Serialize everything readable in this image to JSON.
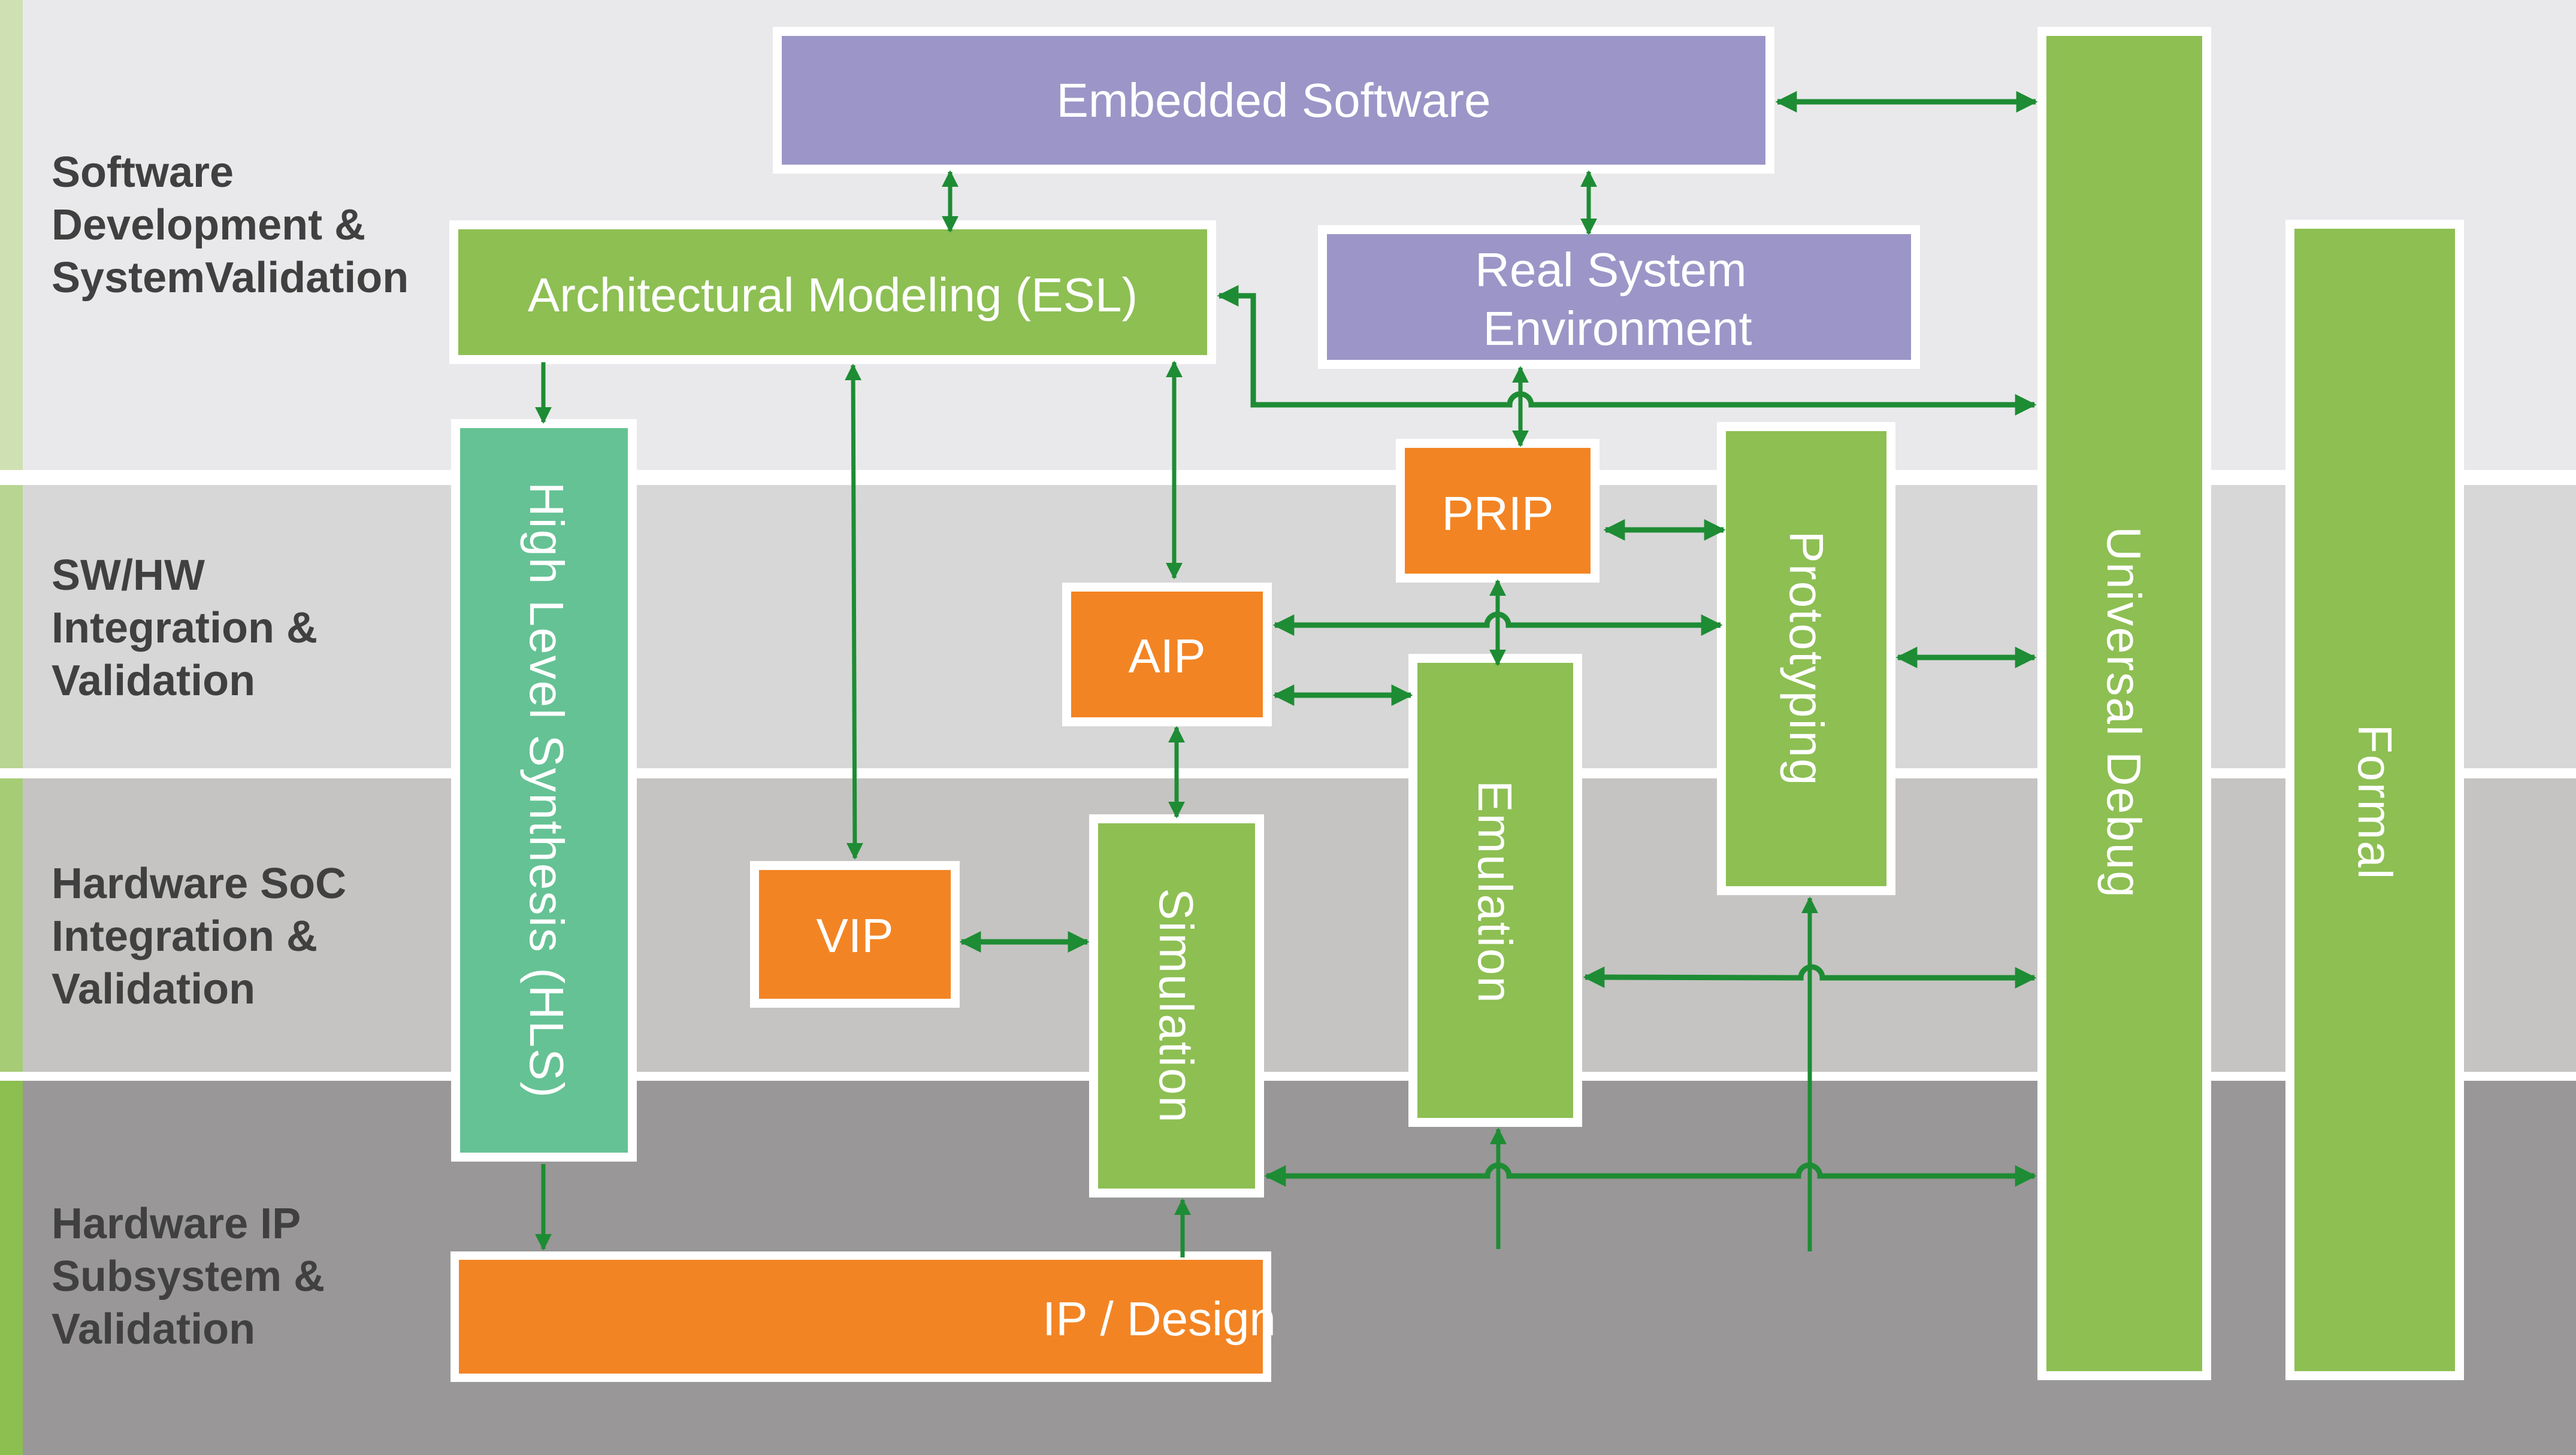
{
  "colors": {
    "band_1": "#e9e9eb",
    "band_2": "#d7d7d7",
    "band_3": "#c5c4c2",
    "band_4": "#999798",
    "accent_1": "#cfe0b3",
    "accent_2": "#b9d592",
    "accent_3": "#a6cc76",
    "accent_4": "#8cbe50",
    "green_box": "#8dbf53",
    "teal_box": "#65c294",
    "orange_box": "#f38423",
    "purple_box": "#9b96c7",
    "connector": "#1e8c34",
    "band_text": "#404040",
    "box_text": "#ffffff"
  },
  "bands": [
    {
      "id": "sw-dev",
      "lines": [
        "Software",
        "Development &",
        "SystemValidation"
      ]
    },
    {
      "id": "swhw",
      "lines": [
        "SW/HW",
        "Integration &",
        "Validation"
      ]
    },
    {
      "id": "hw-soc",
      "lines": [
        "Hardware SoC",
        "Integration &",
        "Validation"
      ]
    },
    {
      "id": "hw-ip",
      "lines": [
        "Hardware IP",
        "Subsystem &",
        "Validation"
      ]
    }
  ],
  "boxes": {
    "embedded_software": {
      "lines": [
        "Embedded Software"
      ],
      "type": "purple"
    },
    "architectural_modeling": {
      "lines": [
        "Architectural Modeling (ESL)"
      ],
      "type": "green"
    },
    "real_system_environment": {
      "lines": [
        "Real System",
        "Environment"
      ],
      "type": "purple"
    },
    "high_level_synthesis": {
      "lines": [
        "High Level Synthesis (HLS)"
      ],
      "type": "teal",
      "vertical": true
    },
    "prip": {
      "lines": [
        "PRIP"
      ],
      "type": "orange"
    },
    "aip": {
      "lines": [
        "AIP"
      ],
      "type": "orange"
    },
    "vip": {
      "lines": [
        "VIP"
      ],
      "type": "orange"
    },
    "simulation": {
      "lines": [
        "Simulation"
      ],
      "type": "green",
      "vertical": true
    },
    "emulation": {
      "lines": [
        "Emulation"
      ],
      "type": "green",
      "vertical": true
    },
    "prototyping": {
      "lines": [
        "Prototyping"
      ],
      "type": "green",
      "vertical": true
    },
    "universal_debug": {
      "lines": [
        "Universal Debug"
      ],
      "type": "green",
      "vertical": true
    },
    "formal": {
      "lines": [
        "Formal"
      ],
      "type": "green",
      "vertical": true
    },
    "ip_design": {
      "lines": [
        "IP / Design"
      ],
      "type": "orange"
    }
  },
  "connections": [
    {
      "from": "embedded_software",
      "to": "architectural_modeling",
      "bidirectional": true
    },
    {
      "from": "embedded_software",
      "to": "real_system_environment",
      "bidirectional": true
    },
    {
      "from": "embedded_software",
      "to": "universal_debug",
      "bidirectional": true
    },
    {
      "from": "architectural_modeling",
      "to": "high_level_synthesis",
      "bidirectional": false
    },
    {
      "from": "architectural_modeling",
      "to": "vip",
      "bidirectional": true
    },
    {
      "from": "architectural_modeling",
      "to": "aip",
      "bidirectional": true
    },
    {
      "from": "universal_debug",
      "to": "architectural_modeling",
      "bidirectional": true
    },
    {
      "from": "real_system_environment",
      "to": "prip",
      "bidirectional": true
    },
    {
      "from": "prip",
      "to": "prototyping",
      "bidirectional": true
    },
    {
      "from": "prip",
      "to": "emulation",
      "bidirectional": true
    },
    {
      "from": "aip",
      "to": "prototyping",
      "bidirectional": true
    },
    {
      "from": "aip",
      "to": "emulation",
      "bidirectional": true
    },
    {
      "from": "aip",
      "to": "simulation",
      "bidirectional": true
    },
    {
      "from": "vip",
      "to": "simulation",
      "bidirectional": true
    },
    {
      "from": "prototyping",
      "to": "universal_debug",
      "bidirectional": true
    },
    {
      "from": "emulation",
      "to": "universal_debug",
      "bidirectional": true
    },
    {
      "from": "simulation",
      "to": "universal_debug",
      "bidirectional": true
    },
    {
      "from": "high_level_synthesis",
      "to": "ip_design",
      "bidirectional": false
    },
    {
      "from": "ip_design",
      "to": "simulation",
      "bidirectional": false
    },
    {
      "from": "ip_design",
      "to": "emulation",
      "bidirectional": false
    },
    {
      "from": "ip_design",
      "to": "prototyping",
      "bidirectional": false
    }
  ]
}
